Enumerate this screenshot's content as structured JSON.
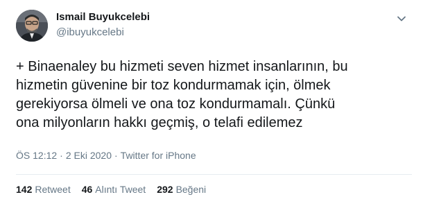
{
  "author": {
    "name": "Ismail Buyukcelebi",
    "handle": "@ibuyukcelebi",
    "avatar_icon": "profile-photo"
  },
  "tweet": {
    "text": "+ Binaenaley bu hizmeti seven hizmet insanlarının, bu\nhizmetin güvenine bir toz kondurmamak için, ölmek\ngerekiyorsa ölmeli ve ona toz kondurmamalı. Çünkü\nona milyonların hakkı geçmiş, o telafi edilemez",
    "time": "ÖS 12:12",
    "date": "2 Eki 2020",
    "separator": "·",
    "source": "Twitter for iPhone"
  },
  "stats": {
    "retweets_count": "142",
    "retweets_label": "Retweet",
    "quotes_count": "46",
    "quotes_label": "Alıntı Tweet",
    "likes_count": "292",
    "likes_label": "Beğeni"
  },
  "colors": {
    "text_primary": "#14171a",
    "text_secondary": "#657786",
    "divider": "#e6ecf0"
  },
  "icons": {
    "more": "chevron-down-icon"
  }
}
